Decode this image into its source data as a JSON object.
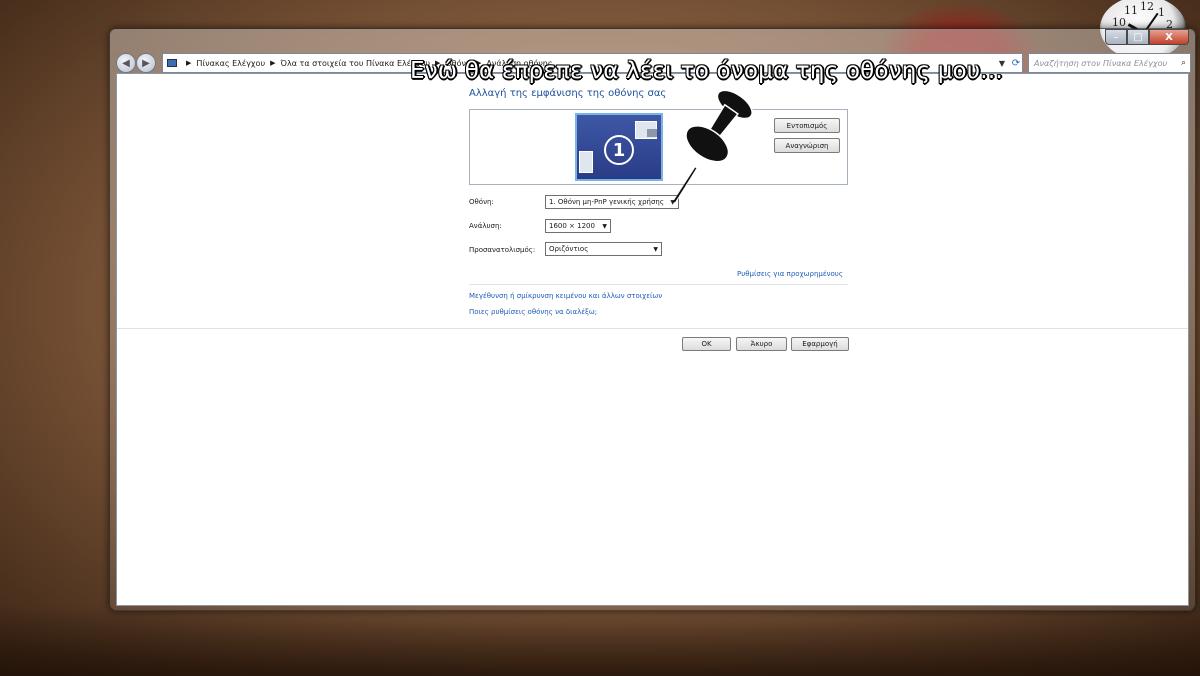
{
  "window": {
    "breadcrumb": [
      "Πίνακας Ελέγχου",
      "Όλα τα στοιχεία του Πίνακα Ελέγχου",
      "Οθόνη",
      "Ανάλυση οθόνης"
    ],
    "search_placeholder": "Αναζήτηση στον Πίνακα Ελέγχου",
    "controls": {
      "minimize": "–",
      "maximize": "□",
      "close": "X"
    }
  },
  "page": {
    "title": "Αλλαγή της εμφάνισης της οθόνης σας",
    "monitor_number": "1",
    "detect_button": "Εντοπισμός",
    "identify_button": "Αναγνώριση",
    "fields": {
      "display_label": "Οθόνη:",
      "display_value": "1. Οθόνη μη-PnP γενικής χρήσης",
      "resolution_label": "Ανάλυση:",
      "resolution_value": "1600 × 1200",
      "orientation_label": "Προσανατολισμός:",
      "orientation_value": "Οριζόντιος"
    },
    "advanced_link": "Ρυθμίσεις για προχωρημένους",
    "links": [
      "Μεγέθυνση ή σμίκρυνση κειμένου και άλλων στοιχείων",
      "Ποιες ρυθμίσεις οθόνης να διαλέξω;"
    ],
    "ok_button": "ΟΚ",
    "cancel_button": "Άκυρο",
    "apply_button": "Εφαρμογή"
  },
  "annotation": {
    "caption": "Ενώ θα έπρεπε να λέει το όνομα της οθόνης μου..."
  },
  "clock": {
    "numbers": [
      "11",
      "12",
      "1",
      "2",
      "10"
    ]
  }
}
